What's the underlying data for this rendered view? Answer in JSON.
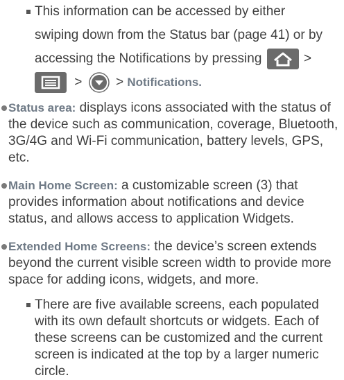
{
  "top_sub_item": {
    "line1": "This information can be accessed by either",
    "line2": "swiping down from the Status bar (page 41) or by",
    "line3": "accessing the Notifications by pressing",
    "gt1": ">",
    "gt2": ">",
    "gt3": ">",
    "notifications_label": "Notifications."
  },
  "items": [
    {
      "term": "Status area:",
      "text": " displays icons associated with the status of the device such as communication, coverage, Bluetooth, 3G/4G and Wi-Fi communication, battery levels, GPS, etc."
    },
    {
      "term": "Main Home Screen:",
      "text": " a customizable screen (3) that provides information about notifications and device status, and allows access to application Widgets."
    },
    {
      "term": "Extended Home Screens:",
      "text": " the device’s screen extends beyond the current visible screen width to provide more space for adding icons, widgets, and more."
    }
  ],
  "bottom_sub_item": {
    "text": "There are five available screens, each populated with its own default shortcuts or widgets. Each of these screens can be customized and the current screen is indicated at the top by a larger numeric circle."
  },
  "icons": {
    "home": "home-key-icon",
    "menu": "menu-key-icon",
    "circle": "chevron-circle-icon"
  }
}
